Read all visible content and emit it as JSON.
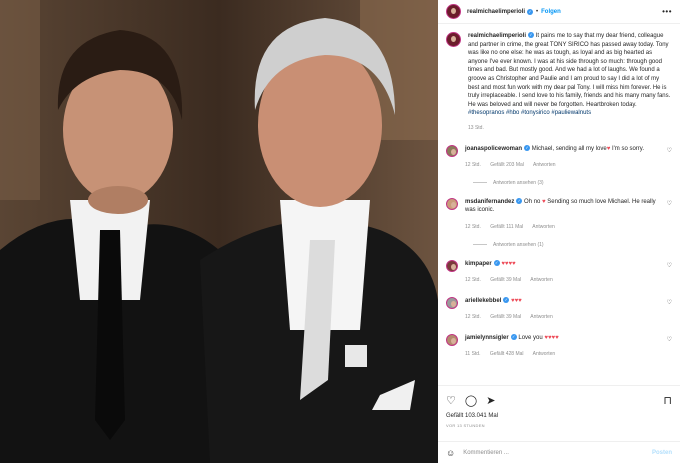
{
  "post": {
    "username": "realmichaelimperioli",
    "follow_label": "Folgen",
    "more": "•••",
    "caption": "It pains me to say that my dear friend, colleague and partner in crime, the great TONY SIRICO has passed away today. Tony was like no one else: he was as tough, as loyal and as big hearted as anyone I've ever known. I was at his side through so much: through good times and bad. But mostly good. And we had a lot of laughs. We found a groove as Christopher and Paulie and I am proud to say I did a lot of my best and most fun work with my dear pal Tony. I will miss him forever. He is truly irreplaceable. I send love to his family, friends and his many many fans. He was beloved and will never be forgotten. Heartbroken today.",
    "hashtags": "#thesopranos #hbo #tonysirico #pauliewalnuts",
    "time": "13 Std."
  },
  "comments": [
    {
      "user": "joanaspolicewoman",
      "text_a": "Michael, sending all my love",
      "text_b": " I'm so sorry.",
      "time": "12 Std.",
      "likes": "Gefällt 203 Mal",
      "reply": "Antworten",
      "replies": "Antworten ansehen (3)"
    },
    {
      "user": "msdanifernandez",
      "text_a": "Oh no ",
      "text_b": " Sending so much love Michael. He really was iconic.",
      "time": "12 Std.",
      "likes": "Gefällt 111 Mal",
      "reply": "Antworten",
      "replies": "Antworten ansehen (1)"
    },
    {
      "user": "kimpaper",
      "text_a": "",
      "text_b": "",
      "hearts": "♥♥♥♥",
      "time": "12 Std.",
      "likes": "Gefällt 39 Mal",
      "reply": "Antworten"
    },
    {
      "user": "ariellekebbel",
      "text_a": "",
      "text_b": "",
      "hearts": "♥♥♥",
      "time": "12 Std.",
      "likes": "Gefällt 39 Mal",
      "reply": "Antworten"
    },
    {
      "user": "jamielynnsigler",
      "text_a": "Love you ",
      "text_b": "",
      "hearts": "♥♥♥♥",
      "time": "11 Std.",
      "likes": "Gefällt 428 Mal",
      "reply": "Antworten"
    }
  ],
  "footer": {
    "likes": "Gefällt 103.041 Mal",
    "date": "VOR 13 STUNDEN",
    "comment_placeholder": "Kommentieren ...",
    "post_label": "Posten",
    "emoji_icon": "smiley-icon"
  }
}
